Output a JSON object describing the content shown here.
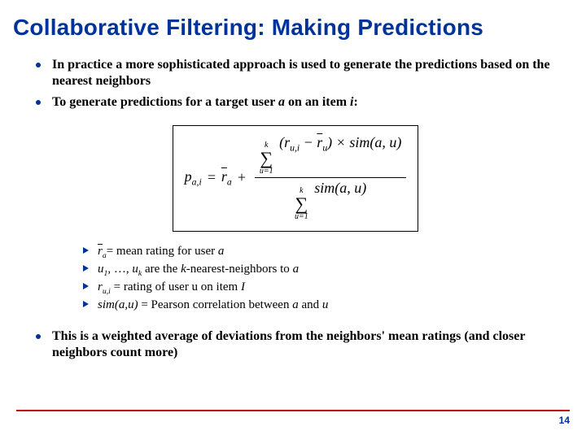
{
  "title": "Collaborative Filtering: Making Predictions",
  "bullets": {
    "b1a": "In practice a more sophisticated approach is used to generate the predictions based on the nearest neighbors",
    "b2_pre": "To generate predictions for a target user ",
    "b2_a": "a",
    "b2_mid": " on an item ",
    "b2_i": "i",
    "b2_post": ":",
    "b3": "This is a weighted average of deviations from the neighbors' mean ratings (and closer neighbors count more)"
  },
  "formula": {
    "lhs_p": "p",
    "lhs_sub": "a,i",
    "eq": " = ",
    "rbar": "r",
    "rbar_sub": "a",
    "plus": " + ",
    "sum_top": "k",
    "sum_bot": "u=1",
    "num_r": "r",
    "num_r_sub": "u,i",
    "num_minus": " − ",
    "num_rbar": "r",
    "num_rbar_sub": "u",
    "num_times": " × ",
    "sim": "sim",
    "sim_args": "(a, u)",
    "lpar": "(",
    "rpar": ")"
  },
  "defs": {
    "d1_pre": "= mean rating for user ",
    "d1_a": "a",
    "d1_sym": "r",
    "d1_sym_sub": "a",
    "d2_u1": "u",
    "d2_u1_sub": "1",
    "d2_mid": ", …, ",
    "d2_uk": "u",
    "d2_uk_sub": "k",
    "d2_txt1": " are the ",
    "d2_k": "k",
    "d2_txt2": "-nearest-neighbors to ",
    "d2_a": "a",
    "d3_r": "r",
    "d3_r_sub": "u,i",
    "d3_txt": " = rating of user u on item ",
    "d3_I": "I",
    "d4_sim": "sim(a,u)",
    "d4_txt1": " = Pearson correlation between ",
    "d4_a": "a",
    "d4_and": " and ",
    "d4_u": "u"
  },
  "page": "14"
}
